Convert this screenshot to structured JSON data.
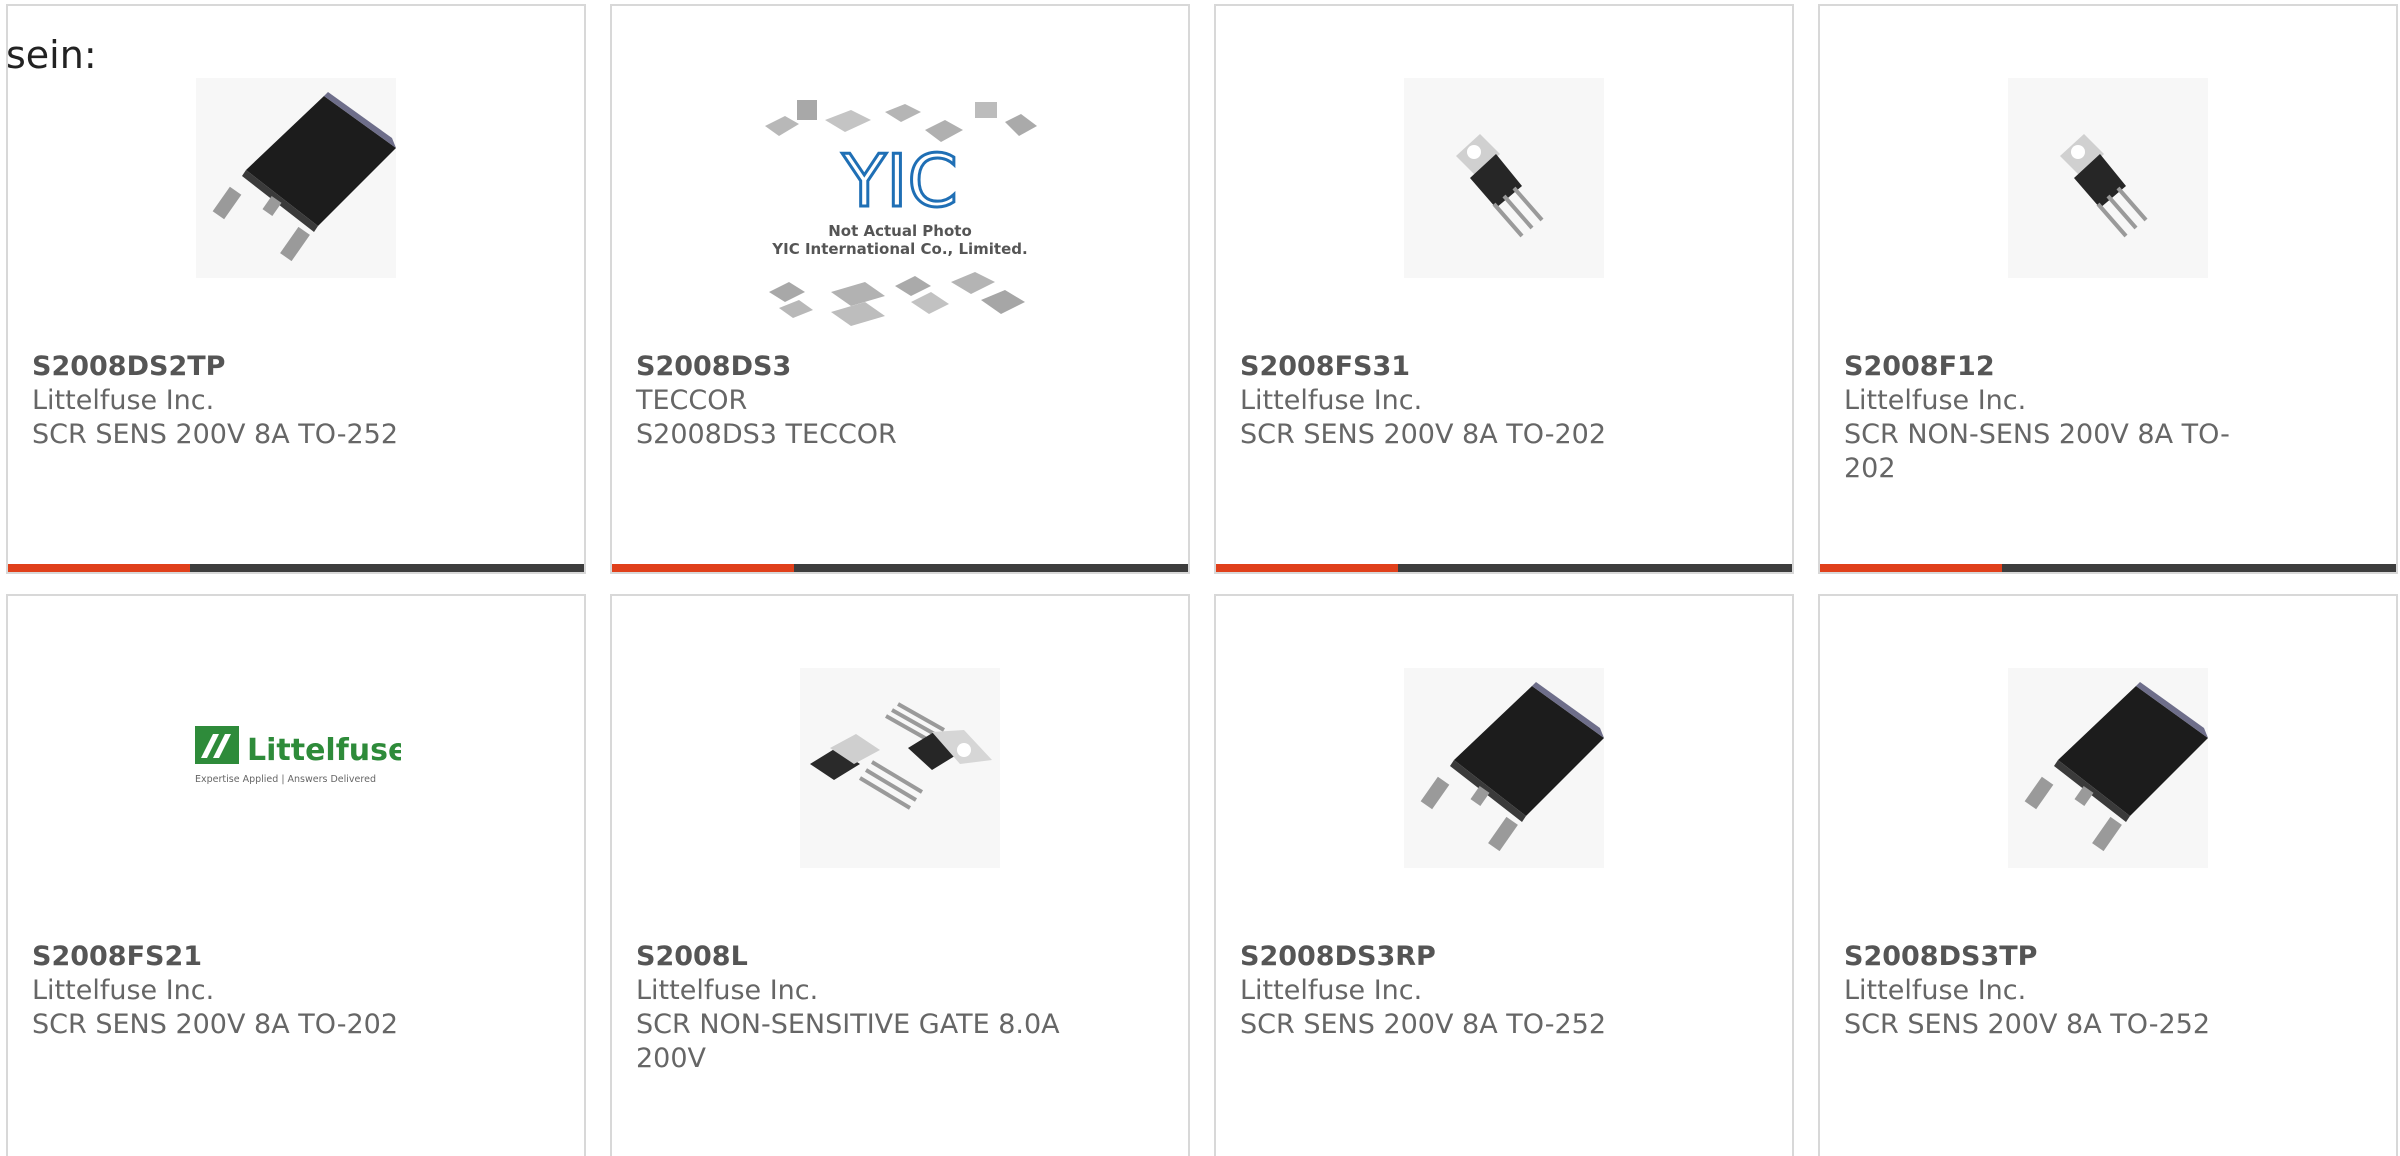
{
  "lead_text": "sein:",
  "products": [
    {
      "part_number": "S2008DS2TP",
      "manufacturer": "Littelfuse Inc.",
      "description": "SCR SENS 200V 8A TO-252",
      "image_icon": "to-252-package-icon"
    },
    {
      "part_number": "S2008DS3",
      "manufacturer": "TECCOR",
      "description": "S2008DS3 TECCOR",
      "image_icon": "not-actual-photo-icon",
      "image_text": {
        "logo": "YIC",
        "line1": "Not Actual Photo",
        "line2": "YIC International Co., Limited."
      }
    },
    {
      "part_number": "S2008FS31",
      "manufacturer": "Littelfuse Inc.",
      "description": "SCR SENS 200V 8A TO-202",
      "image_icon": "to-202-package-icon"
    },
    {
      "part_number": "S2008F12",
      "manufacturer": "Littelfuse Inc.",
      "description": "SCR NON-SENS 200V 8A TO-202",
      "image_icon": "to-202-package-icon"
    },
    {
      "part_number": "S2008FS21",
      "manufacturer": "Littelfuse Inc.",
      "description": "SCR SENS 200V 8A TO-202",
      "image_icon": "littelfuse-logo-icon",
      "image_text": {
        "logo": "Littelfuse",
        "tagline": "Expertise Applied | Answers Delivered"
      }
    },
    {
      "part_number": "S2008L",
      "manufacturer": "Littelfuse Inc.",
      "description": "SCR NON-SENSITIVE GATE 8.0A 200V",
      "image_icon": "to-220-package-icon"
    },
    {
      "part_number": "S2008DS3RP",
      "manufacturer": "Littelfuse Inc.",
      "description": "SCR SENS 200V 8A TO-252",
      "image_icon": "to-252-package-icon"
    },
    {
      "part_number": "S2008DS3TP",
      "manufacturer": "Littelfuse Inc.",
      "description": "SCR SENS 200V 8A TO-252",
      "image_icon": "to-252-package-icon"
    }
  ],
  "colors": {
    "accent": "#e0401b",
    "bar_dark": "#3d3d3d",
    "card_border": "#d8d8d8",
    "littelfuse_green": "#2e8b3a",
    "yic_blue": "#1f6fb5"
  }
}
